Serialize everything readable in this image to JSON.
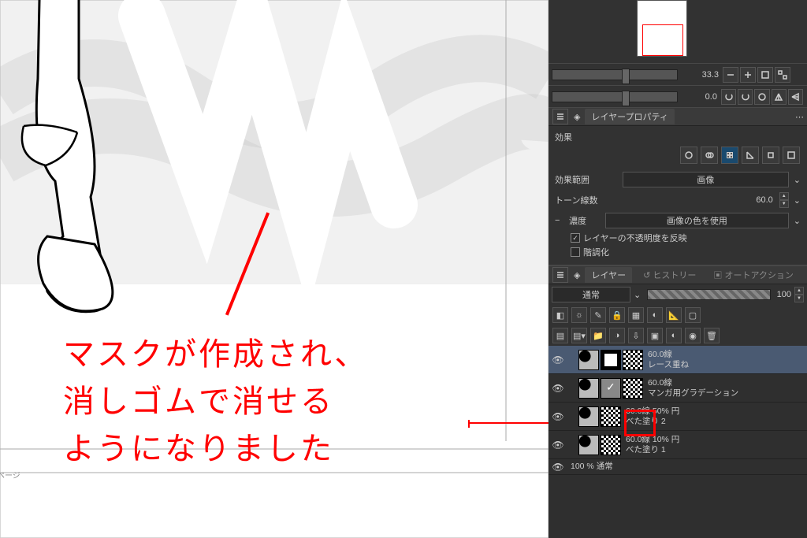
{
  "page_label": "ページ",
  "annotation": {
    "line1": "マスクが作成され、",
    "line2": "消しゴムで消せる",
    "line3": "ようになりました"
  },
  "navigator": {
    "zoom_value": "33.3",
    "rotate_value": "0.0"
  },
  "layer_property": {
    "tab_label": "レイヤープロパティ",
    "effect_label": "効果",
    "scope_label": "効果範囲",
    "scope_value": "画像",
    "tone_lines_label": "トーン線数",
    "tone_lines_value": "60.0",
    "density_label": "濃度",
    "density_value": "画像の色を使用",
    "reflect_opacity_label": "レイヤーの不透明度を反映",
    "reflect_opacity_checked": true,
    "posterize_label": "階調化",
    "posterize_checked": false
  },
  "layer_panel": {
    "tab_layers": "レイヤー",
    "tab_history": "ヒストリー",
    "tab_autoaction": "オートアクション",
    "blend_mode": "通常",
    "opacity_value": "100",
    "layers": [
      {
        "name_line1": "60.0線",
        "name_line2": "レース重ね",
        "selected": true
      },
      {
        "name_line1": "60.0線",
        "name_line2": "マンガ用グラデーション",
        "selected": false
      },
      {
        "name_line1": "60.0線 50% 円",
        "name_line2": "べた塗り 2",
        "selected": false
      },
      {
        "name_line1": "60.0線 10% 円",
        "name_line2": "べた塗り 1",
        "selected": false
      },
      {
        "name_line1": "100 % 通常",
        "name_line2": "",
        "selected": false
      }
    ]
  }
}
